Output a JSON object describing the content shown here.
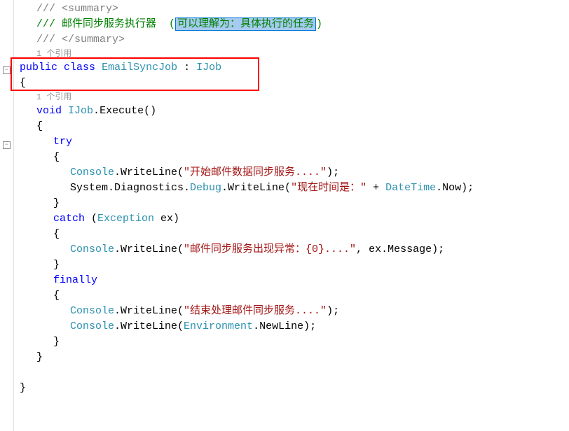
{
  "summary": {
    "open": "/// <summary>",
    "text_prefix": "/// 邮件同步服务执行器  (",
    "text_highlight": "可以理解为：具体执行的任务",
    "text_suffix": ")",
    "close": "/// </summary>"
  },
  "codelens": {
    "ref1": "1 个引用",
    "ref2": "1 个引用"
  },
  "code": {
    "class_public": "public",
    "class_keyword": "class",
    "class_name": "EmailSyncJob",
    "class_colon": " : ",
    "class_interface": "IJob",
    "brace_open": "{",
    "brace_close": "}",
    "void": "void",
    "ijob": "IJob",
    "dot": ".",
    "execute": "Execute()",
    "try": "try",
    "catch": "catch",
    "finally": "finally",
    "exception": "Exception",
    "ex": " ex)",
    "paren_open": " (",
    "console": "Console",
    "writeline": ".WriteLine(",
    "str_start": "\"开始邮件数据同步服务....\"",
    "str_now_prefix": "\"现在时间是：\"",
    "str_exception": "\"邮件同步服务出现异常：{0}....\"",
    "str_end": "\"结束处理邮件同步服务....\"",
    "close_paren": ");",
    "system_diag": "System.Diagnostics.",
    "debug": "Debug",
    "plus": " + ",
    "datetime": "DateTime",
    "now": ".Now);",
    "ex_msg": ", ex.Message);",
    "environment": "Environment",
    "newline": ".NewLine);"
  },
  "fold": {
    "minus": "−"
  }
}
